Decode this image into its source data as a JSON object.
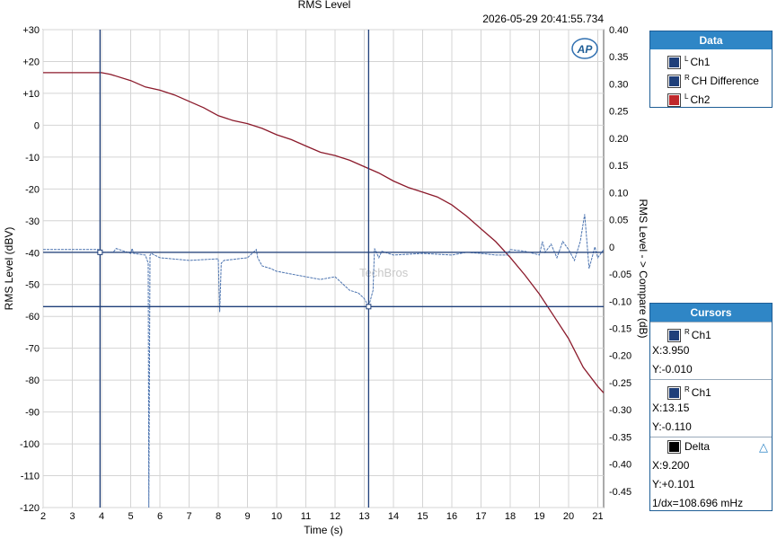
{
  "title": "RMS Level",
  "timestamp": "2026-05-29 20:41:55.734",
  "watermark": "TechBros",
  "logo": "AP",
  "legend": {
    "header": "Data",
    "items": [
      {
        "sup": "L",
        "label": "Ch1",
        "color": "#1f3f7a"
      },
      {
        "sup": "R",
        "label": "CH Difference",
        "color": "#1f3f7a"
      },
      {
        "sup": "L",
        "label": "Ch2",
        "color": "#c0282c"
      }
    ]
  },
  "cursors": {
    "header": "Cursors",
    "c1": {
      "sup": "R",
      "label": "Ch1",
      "x": "X:3.950",
      "y": "Y:-0.010",
      "color": "#1f3f7a"
    },
    "c2": {
      "sup": "R",
      "label": "Ch1",
      "x": "X:13.15",
      "y": "Y:-0.110",
      "color": "#1f3f7a"
    },
    "delta": {
      "label": "Delta",
      "x": "X:9.200",
      "y": "Y:+0.101",
      "inv": "1/dx=108.696 mHz",
      "color": "#000000",
      "icon": "delta-triangle-icon"
    }
  },
  "chart_data": {
    "type": "line",
    "xlabel": "Time (s)",
    "ylabel": "RMS Level (dBV)",
    "y2label": "RMS Level - > Compare (dB)",
    "xlim": [
      2,
      21.2
    ],
    "ylim": [
      -120,
      30
    ],
    "y2lim": [
      -0.48,
      0.4
    ],
    "x_ticks": [
      "2",
      "3",
      "4",
      "5",
      "6",
      "7",
      "8",
      "9",
      "10",
      "11",
      "12",
      "13",
      "14",
      "15",
      "16",
      "17",
      "18",
      "19",
      "20",
      "21"
    ],
    "y_ticks": [
      "+30",
      "+20",
      "+10",
      "0",
      "-10",
      "-20",
      "-30",
      "-40",
      "-50",
      "-60",
      "-70",
      "-80",
      "-90",
      "-100",
      "-110",
      "-120"
    ],
    "y2_ticks": [
      "0.40",
      "0.35",
      "0.30",
      "0.25",
      "0.20",
      "0.15",
      "0.10",
      "0.05",
      "0",
      "-0.05",
      "-0.10",
      "-0.15",
      "-0.20",
      "-0.25",
      "-0.30",
      "-0.35",
      "-0.40",
      "-0.45"
    ],
    "grid": true,
    "series": [
      {
        "name": "Ch2",
        "axis": "left",
        "color": "#8b1a2b",
        "x": [
          2.0,
          4.0,
          4.3,
          5.0,
          5.5,
          6.0,
          6.5,
          7.0,
          7.5,
          8.0,
          8.5,
          9.0,
          9.5,
          10.0,
          10.5,
          11.0,
          11.5,
          12.0,
          12.5,
          13.0,
          13.5,
          14.0,
          14.5,
          15.0,
          15.5,
          16.0,
          16.5,
          17.0,
          17.5,
          18.0,
          18.5,
          19.0,
          19.5,
          20.0,
          20.5,
          21.0,
          21.2
        ],
        "y": [
          16.5,
          16.5,
          16.0,
          14.0,
          12.0,
          11.0,
          9.5,
          7.5,
          5.5,
          3.0,
          1.5,
          0.5,
          -1.0,
          -3.0,
          -4.5,
          -6.5,
          -8.5,
          -9.5,
          -11.0,
          -13.0,
          -15.0,
          -17.5,
          -19.5,
          -21.0,
          -22.5,
          -25.0,
          -28.5,
          -32.5,
          -36.5,
          -41.5,
          -47.0,
          -53.0,
          -60.0,
          -67.0,
          -76.0,
          -82.0,
          -84.0
        ]
      },
      {
        "name": "CH Difference",
        "axis": "right",
        "color": "#4c74b0",
        "x": [
          2.0,
          3.9,
          4.0,
          4.4,
          4.5,
          5.0,
          5.05,
          5.1,
          5.5,
          5.6,
          5.62,
          5.66,
          5.7,
          6.0,
          7.0,
          8.0,
          8.05,
          8.1,
          8.2,
          9.0,
          9.3,
          9.35,
          9.5,
          9.8,
          10.0,
          11.0,
          11.5,
          12.0,
          12.5,
          12.8,
          13.0,
          13.15,
          13.3,
          13.35,
          13.5,
          13.6,
          14.0,
          15.0,
          16.0,
          16.5,
          17.0,
          17.5,
          17.9,
          18.0,
          18.5,
          19.0,
          19.1,
          19.2,
          19.4,
          19.6,
          19.8,
          20.0,
          20.2,
          20.4,
          20.55,
          20.7,
          20.9,
          21.0,
          21.2
        ],
        "y": [
          -0.005,
          -0.005,
          -0.01,
          -0.01,
          -0.003,
          -0.012,
          -0.003,
          -0.012,
          -0.015,
          -0.03,
          -0.48,
          -0.015,
          -0.012,
          -0.02,
          -0.025,
          -0.022,
          -0.12,
          -0.03,
          -0.025,
          -0.02,
          -0.005,
          -0.02,
          -0.035,
          -0.04,
          -0.045,
          -0.055,
          -0.06,
          -0.055,
          -0.08,
          -0.085,
          -0.095,
          -0.11,
          -0.08,
          -0.003,
          -0.02,
          -0.008,
          -0.015,
          -0.012,
          -0.015,
          -0.01,
          -0.012,
          -0.015,
          -0.015,
          -0.005,
          -0.008,
          -0.015,
          0.01,
          -0.01,
          0.005,
          -0.02,
          0.01,
          -0.005,
          -0.025,
          0.01,
          0.06,
          -0.04,
          0.0,
          -0.02,
          -0.005
        ]
      }
    ],
    "cursors": [
      {
        "x": 3.95,
        "y": -0.01
      },
      {
        "x": 13.15,
        "y": -0.11
      }
    ]
  }
}
